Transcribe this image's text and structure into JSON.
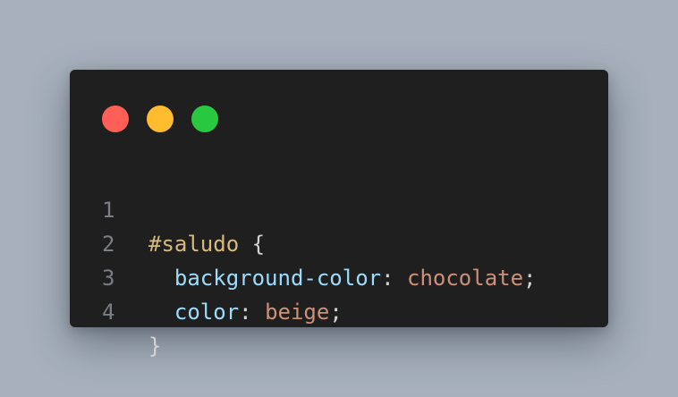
{
  "window": {
    "controls": [
      {
        "name": "close",
        "color": "#ff5f57"
      },
      {
        "name": "minimize",
        "color": "#febc2e"
      },
      {
        "name": "maximize",
        "color": "#28c840"
      }
    ]
  },
  "code": {
    "lines": [
      {
        "number": "1",
        "selector": "#saludo",
        "brace": " {"
      },
      {
        "number": "2",
        "indent": "  ",
        "property": "background-color",
        "colon": ": ",
        "value": "chocolate",
        "semicolon": ";"
      },
      {
        "number": "3",
        "indent": "  ",
        "property": "color",
        "colon": ": ",
        "value": "beige",
        "semicolon": ";"
      },
      {
        "number": "4",
        "brace": "}"
      }
    ]
  }
}
